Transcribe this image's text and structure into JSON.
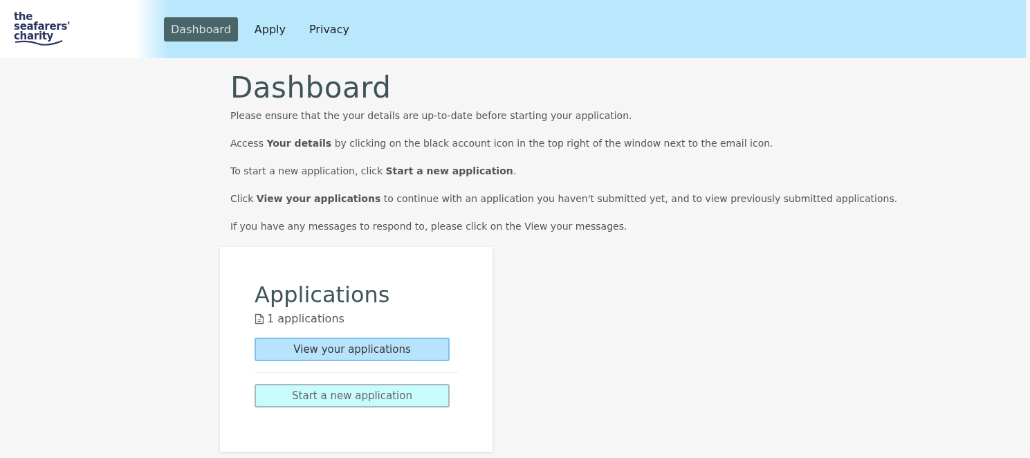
{
  "header": {
    "logo_lines": [
      "the",
      "seafarers'",
      "charity"
    ],
    "nav": [
      {
        "label": "Dashboard",
        "selected": true
      },
      {
        "label": "Apply",
        "selected": false
      },
      {
        "label": "Privacy",
        "selected": false
      }
    ]
  },
  "page": {
    "title": "Dashboard",
    "paragraphs": [
      "Please ensure that the your details are up-to-date before starting your application.",
      "Access **Your details** by clicking on the black account icon in the top right of the window next to the email icon.",
      "To start a new application, click **Start a new application**.",
      "Click **View your applications** to continue with an application you haven't submitted yet, and to view previously submitted applications.",
      "If you have any messages to respond to, please click on the View your messages."
    ]
  },
  "card": {
    "title": "Applications",
    "count": "1 applications",
    "buttons": [
      {
        "label": "View your applications",
        "kind": "primary"
      },
      {
        "label": "Start a new application",
        "kind": "secondary"
      }
    ]
  }
}
